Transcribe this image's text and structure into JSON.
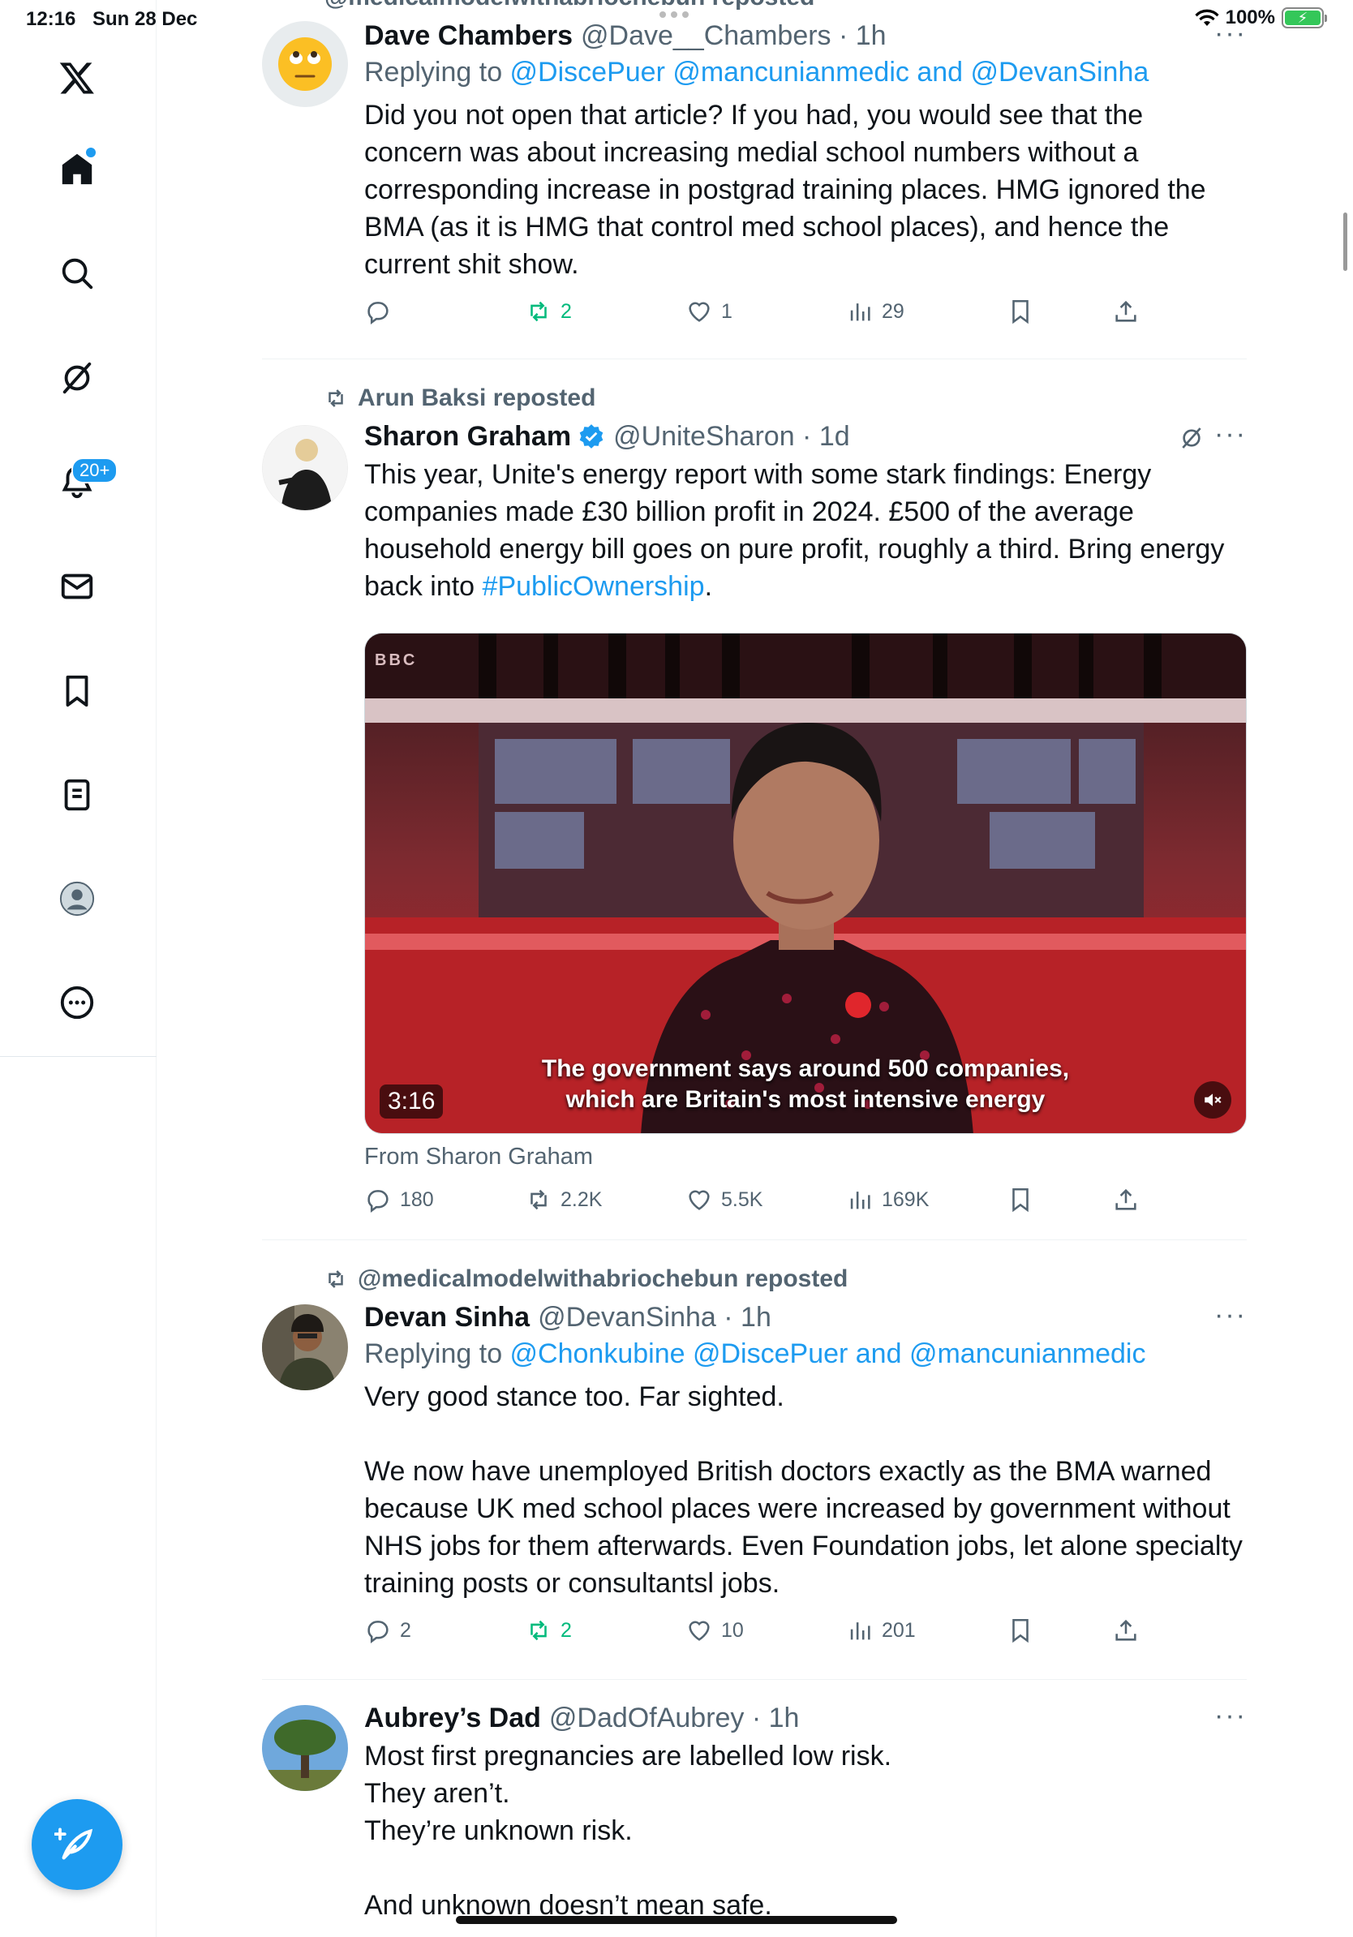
{
  "status": {
    "time": "12:16",
    "date": "Sun 28 Dec",
    "battery": "100%"
  },
  "sidebar": {
    "notifications_badge": "20+"
  },
  "feed": {
    "top_partial_repost": "@medicalmodelwithabriochebun reposted",
    "tweets": [
      {
        "name": "Dave Chambers",
        "handle": "@Dave__Chambers · 1h",
        "reply_prefix": "Replying to ",
        "reply_to": "@DiscePuer @mancunianmedic and @DevanSinha",
        "text": "Did you not open that article? If you had, you would see that the concern was about increasing medial school numbers without a corresponding increase in postgrad training places. HMG ignored the BMA (as it is HMG that control med school places), and hence the current shit show.",
        "replies": "",
        "reposts": "2",
        "likes": "1",
        "views": "29"
      },
      {
        "repost_by": "Arun Baksi reposted",
        "name": "Sharon Graham",
        "handle": "@UniteSharon · 1d",
        "text_before": "This year, Unite's energy report with some stark findings: Energy companies made £30 billion profit in 2024. £500 of the average household energy bill goes on pure profit, roughly a third. Bring energy back into ",
        "hashtag": "#PublicOwnership",
        "text_after": ".",
        "video": {
          "caption_line1": "The government says around 500 companies,",
          "caption_line2": "which are Britain's most intensive energy",
          "duration": "3:16",
          "watermark": "BBC"
        },
        "from": "From Sharon Graham",
        "replies": "180",
        "reposts": "2.2K",
        "likes": "5.5K",
        "views": "169K"
      },
      {
        "repost_by": "@medicalmodelwithabriochebun reposted",
        "name": "Devan Sinha",
        "handle": "@DevanSinha · 1h",
        "reply_prefix": "Replying to ",
        "reply_to": "@Chonkubine @DiscePuer and @mancunianmedic",
        "text_p1": "Very good stance too. Far sighted.",
        "text_p2": "We now have unemployed British doctors exactly as the BMA warned because UK med school places were increased by government without NHS jobs for them afterwards. Even Foundation jobs, let alone specialty training posts or consultantsl jobs.",
        "replies": "2",
        "reposts": "2",
        "likes": "10",
        "views": "201"
      },
      {
        "name": "Aubrey’s Dad",
        "handle": "@DadOfAubrey · 1h",
        "lines": [
          "Most first pregnancies are labelled low risk.",
          "They aren’t.",
          "They’re unknown risk.",
          "",
          "And unknown doesn’t mean safe."
        ]
      }
    ]
  }
}
